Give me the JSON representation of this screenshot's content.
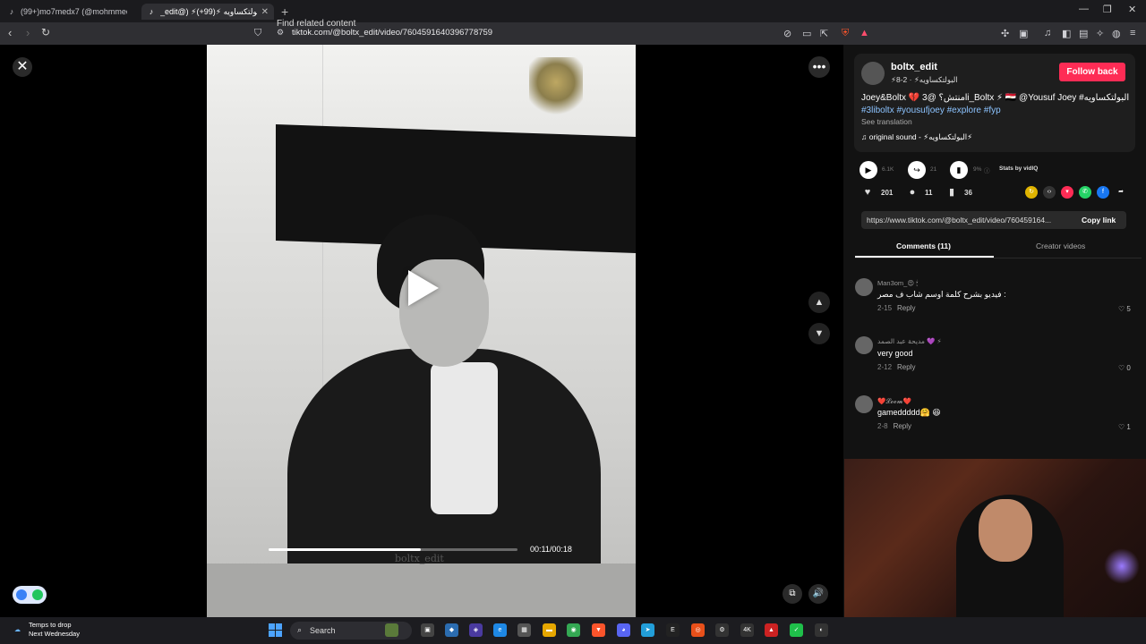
{
  "browser": {
    "tabs": [
      {
        "title": "(99+)mo7medx7 (@mohmmedlbib) |",
        "icon": "tiktok-icon"
      },
      {
        "title": "_edit@) ⚡البولتكساويه ⚡(99+)",
        "icon": "tiktok-icon",
        "close": "✕"
      }
    ],
    "new_tab": "+",
    "url": "tiktok.com/@boltx_edit/video/7604591640396778759"
  },
  "video": {
    "search_hint": "Find related content",
    "time": "00:11/00:18",
    "progress": 0.61,
    "watermark": "boltx_edit"
  },
  "author": {
    "name": "boltx_edit",
    "subtitle": "⚡البولتكساويه⚡ · 2-8",
    "follow_label": "Follow back",
    "caption_line1": "Joey&Boltx 💔 منتش؟ @3li_Boltx ⚡ 🇪🇬 @Yousuf Joey #البولتكساويه",
    "caption_line2": "#3liboltx #yousufjoey #explore #fyp",
    "see_translation": "See translation",
    "sound": "♫ original sound - ⚡البولتكساويه⚡"
  },
  "stats": {
    "plays": "6.1K",
    "shares_count": "21",
    "engagement": "9%",
    "vidiq_label": "Stats by vidIQ",
    "likes": "201",
    "comments": "11",
    "saves": "36"
  },
  "link": {
    "url": "https://www.tiktok.com/@boltx_edit/video/760459164...",
    "copy_label": "Copy link"
  },
  "tabs": {
    "comments": "Comments (11)",
    "creator_videos": "Creator videos"
  },
  "comments": [
    {
      "user": "Man3om_😍 🕯",
      "text": "فيديو بشرح كلمة اوسم شاب ف مصر :",
      "date": "2-15",
      "reply": "Reply",
      "likes": "5"
    },
    {
      "user": "مديحة عبد الصمد 💜 ⚡",
      "text": "very good",
      "date": "2-12",
      "reply": "Reply",
      "likes": "0"
    },
    {
      "user": "❤️𝓛𝓸𝓸𝓶❤️",
      "text": "gameddddd🤗 😆",
      "date": "2-8",
      "reply": "Reply",
      "likes": "1"
    }
  ],
  "taskbar": {
    "weather_line1": "Temps to drop",
    "weather_line2": "Next Wednesday",
    "search_label": "Search"
  },
  "colors": {
    "follow": "#fe2c55",
    "hashtag": "#8cc3ff",
    "panel_bg": "#121212"
  }
}
